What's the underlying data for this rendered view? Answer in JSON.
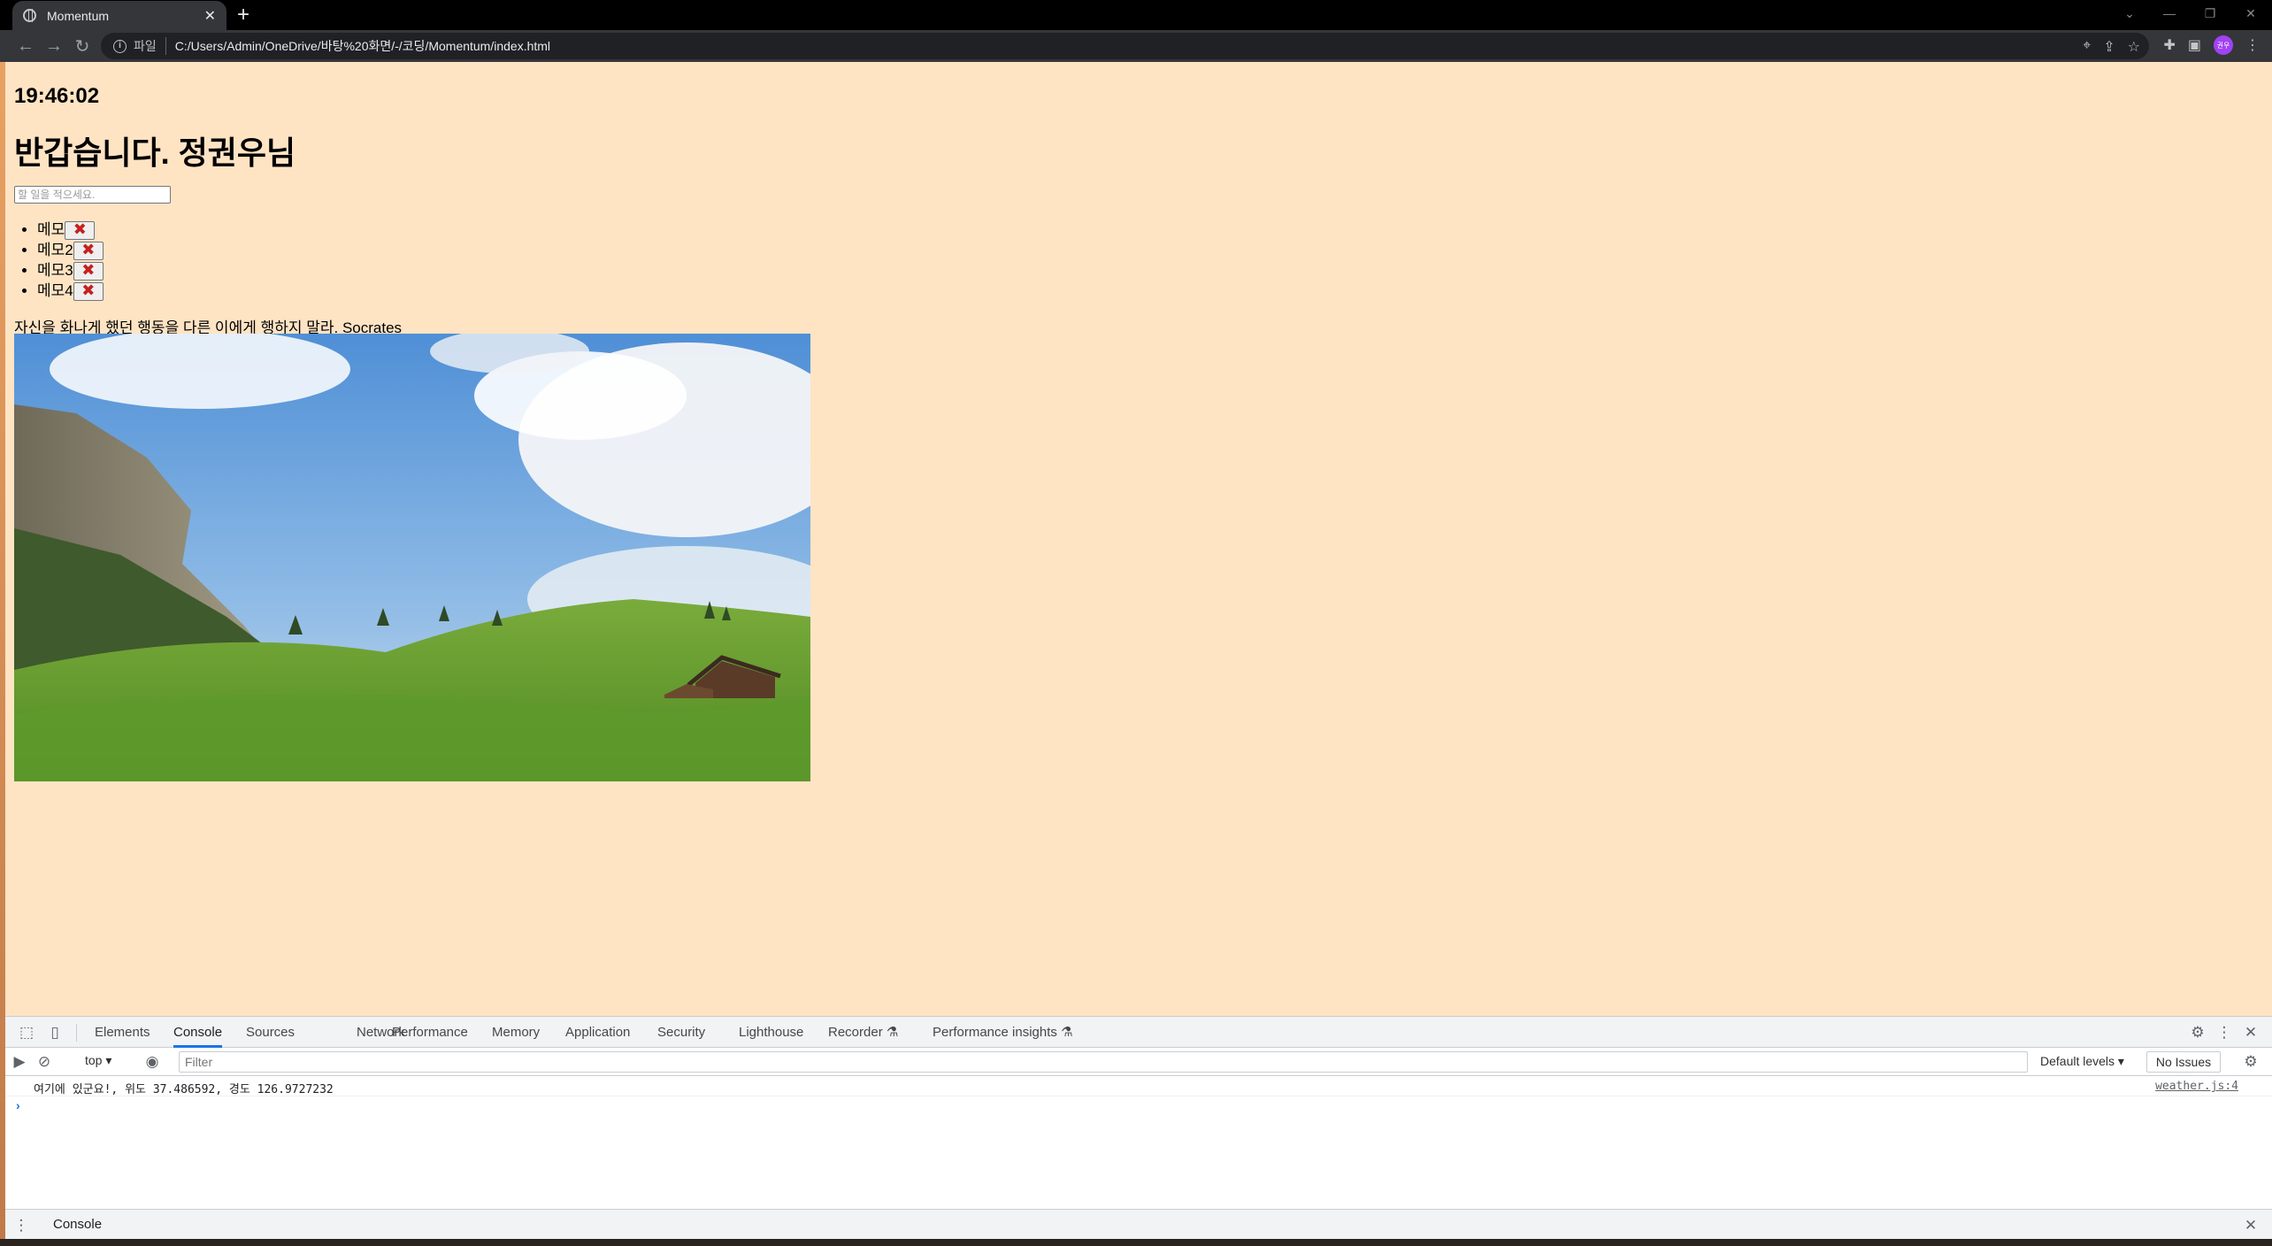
{
  "browser": {
    "tab_title": "Momentum",
    "tab_close_glyph": "✕",
    "new_tab_glyph": "+",
    "protocol_label": "파일",
    "url": "C:/Users/Admin/OneDrive/바탕%20화면/-/코딩/Momentum/index.html",
    "avatar_text": "권우"
  },
  "page": {
    "clock": "19:46:02",
    "greeting": "반갑습니다. 정권우님",
    "todo_placeholder": "할 일을 적으세요.",
    "todos": [
      "메모",
      "메모2",
      "메모3",
      "메모4"
    ],
    "delete_glyph": "✖",
    "quote": "자신을 화나게 했던 행동을 다른 이에게 행하지 말라. Socrates",
    "background_color": "#ffe4c4"
  },
  "devtools": {
    "tabs": [
      "Elements",
      "Console",
      "Sources",
      "Network",
      "Performance",
      "Memory",
      "Application",
      "Security",
      "Lighthouse",
      "Recorder ⚗",
      "Performance insights ⚗"
    ],
    "active_tab": "Console",
    "context": "top ▾",
    "filter_placeholder": "Filter",
    "levels": "Default levels ▾",
    "issues": "No Issues",
    "log_message": "여기에 있군요!, 위도 37.486592, 경도 126.9727232",
    "log_source": "weather.js:4",
    "prompt": "›",
    "drawer_tab": "Console"
  }
}
